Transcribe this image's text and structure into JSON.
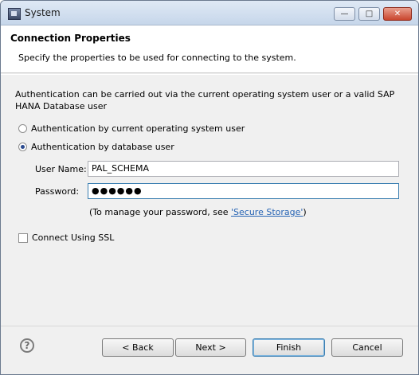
{
  "window": {
    "title": "System",
    "controls": {
      "minimize": "—",
      "maximize": "□",
      "close": "✕"
    },
    "icon": "system-icon"
  },
  "banner": {
    "title": "Connection Properties",
    "description": "Specify the properties to be used for connecting to the system."
  },
  "auth": {
    "intro": "Authentication can be carried out via the current operating system user or a valid SAP HANA Database user",
    "options": [
      {
        "label": "Authentication by current operating system user",
        "selected": false
      },
      {
        "label": "Authentication by database user",
        "selected": true
      }
    ]
  },
  "form": {
    "user_label": "User Name:",
    "user_value": "PAL_SCHEMA",
    "password_label": "Password:",
    "password_value": "●●●●●●",
    "note_prefix": "(To manage your password, see ",
    "note_link": "'Secure Storage'",
    "note_suffix": ")"
  },
  "ssl": {
    "label": "Connect Using SSL",
    "checked": false
  },
  "buttons": {
    "help": "?",
    "back": "< Back",
    "next": "Next >",
    "finish": "Finish",
    "cancel": "Cancel"
  }
}
